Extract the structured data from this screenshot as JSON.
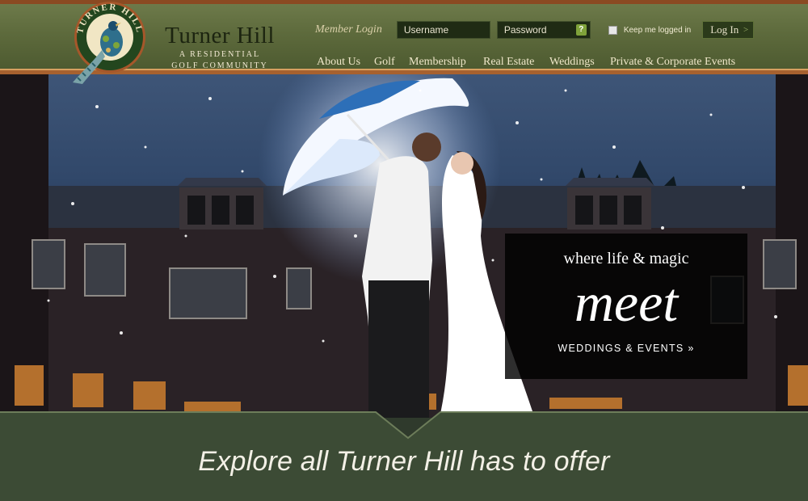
{
  "site": {
    "logo_text": "TURNER HILL",
    "brand_name": "Turner Hill",
    "brand_subtitle_line1": "A RESIDENTIAL",
    "brand_subtitle_line2": "GOLF COMMUNITY"
  },
  "login": {
    "label": "Member Login",
    "username_placeholder": "Username",
    "password_placeholder": "Password",
    "help_icon": "?",
    "remember_label": "Keep me logged in",
    "submit_label": "Log In",
    "submit_icon": ">"
  },
  "nav": {
    "items": [
      {
        "label": "About Us"
      },
      {
        "label": "Golf"
      },
      {
        "label": "Membership"
      },
      {
        "label": "Real Estate"
      },
      {
        "label": "Weddings"
      },
      {
        "label": "Private & Corporate Events"
      }
    ]
  },
  "hero": {
    "image": "wedding-couple-under-umbrella-at-night",
    "tagline": "where life & magic",
    "headline": "meet",
    "cta": "WEDDINGS & EVENTS »"
  },
  "footer_band": {
    "heading": "Explore all Turner Hill has to offer"
  },
  "colors": {
    "header_green": "#5d6a3c",
    "border_orange": "#a7612f",
    "band_green": "#3b4a34"
  }
}
